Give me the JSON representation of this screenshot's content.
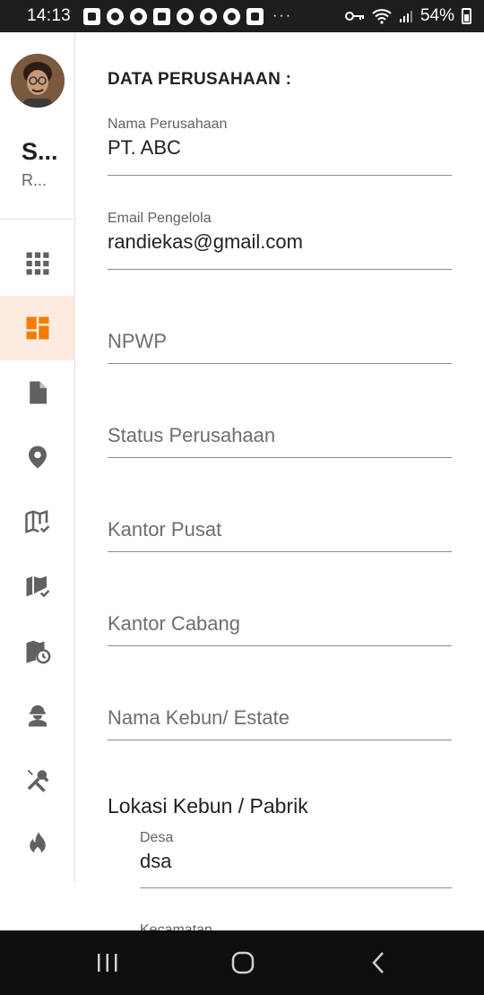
{
  "status_bar": {
    "time": "14:13",
    "more": "···",
    "battery": "54%",
    "app_icons": [
      "line-icon",
      "telegram-icon",
      "whatsapp-icon",
      "gallery-icon",
      "vimeo-icon",
      "app-icon",
      "app-icon",
      "instagram-icon"
    ]
  },
  "user": {
    "name": "S...",
    "role": "R..."
  },
  "sidebar": {
    "accent": "#f57c00",
    "active_bg": "#fdebe0",
    "items": [
      {
        "icon": "apps-grid-icon",
        "active": false
      },
      {
        "icon": "dashboard-icon",
        "active": true
      },
      {
        "icon": "document-icon",
        "active": false
      },
      {
        "icon": "location-pin-icon",
        "active": false
      },
      {
        "icon": "map-check-outline-icon",
        "active": false
      },
      {
        "icon": "map-check-icon",
        "active": false
      },
      {
        "icon": "map-clock-icon",
        "active": false
      },
      {
        "icon": "worker-icon",
        "active": false
      },
      {
        "icon": "tools-icon",
        "active": false
      },
      {
        "icon": "fire-icon",
        "active": false
      }
    ]
  },
  "form": {
    "title": "DATA PERUSAHAAN :",
    "nama_perusahaan": {
      "label": "Nama Perusahaan",
      "value": "PT. ABC"
    },
    "email_pengelola": {
      "label": "Email Pengelola",
      "value": "randiekas@gmail.com"
    },
    "npwp": {
      "placeholder": "NPWP"
    },
    "status_perusahaan": {
      "placeholder": "Status Perusahaan"
    },
    "kantor_pusat": {
      "placeholder": "Kantor Pusat"
    },
    "kantor_cabang": {
      "placeholder": "Kantor Cabang"
    },
    "nama_kebun": {
      "placeholder": "Nama Kebun/ Estate"
    },
    "lokasi": {
      "heading": "Lokasi Kebun / Pabrik",
      "desa": {
        "label": "Desa",
        "value": "dsa"
      },
      "kecamatan": {
        "label": "Kecamatan"
      }
    }
  }
}
